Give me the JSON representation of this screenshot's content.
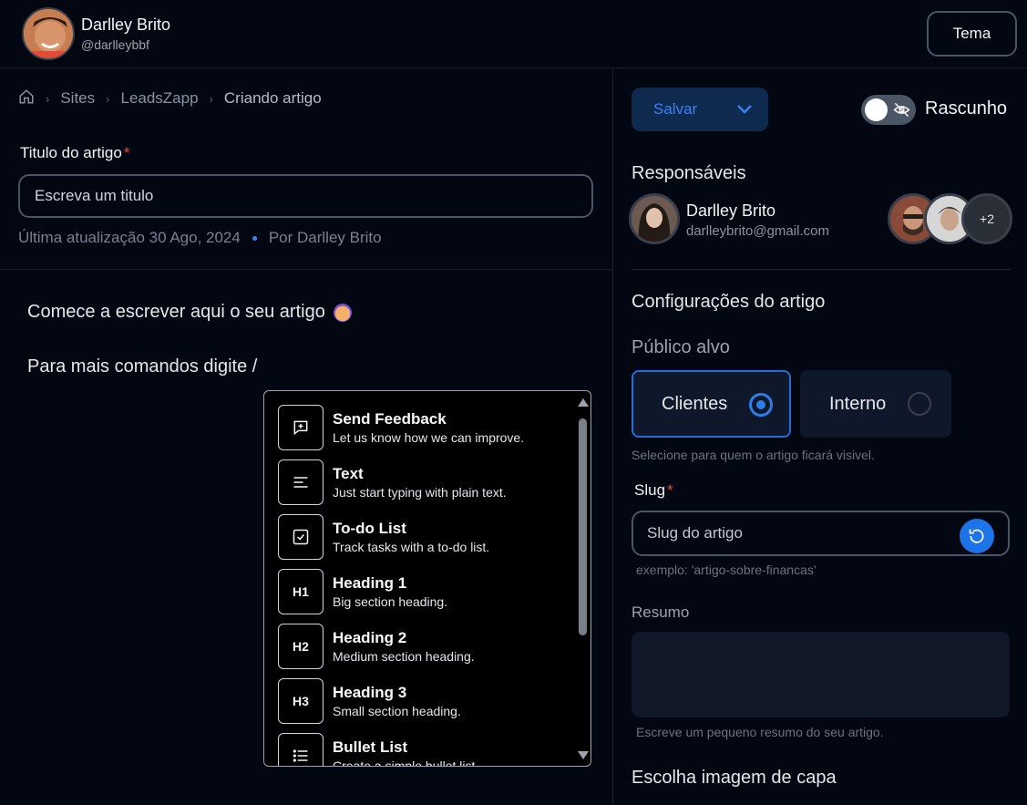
{
  "header": {
    "user_name": "Darlley Brito",
    "user_handle": "@darlleybbf",
    "theme_button": "Tema"
  },
  "breadcrumb": {
    "items": [
      "Sites",
      "LeadsZapp"
    ],
    "current": "Criando artigo"
  },
  "article": {
    "title_label": "Titulo do artigo",
    "required_mark": "*",
    "title_placeholder": "Escreva um titulo",
    "last_update": "Última atualização 30 Ago, 2024",
    "author": "Por Darlley Brito"
  },
  "editor": {
    "line1": "Comece a escrever aqui o seu artigo",
    "line2": "Para mais comandos digite /"
  },
  "command_menu": {
    "items": [
      {
        "title": "Send Feedback",
        "desc": "Let us know how we can improve.",
        "icon": "feedback-icon"
      },
      {
        "title": "Text",
        "desc": "Just start typing with plain text.",
        "icon": "text-icon"
      },
      {
        "title": "To-do List",
        "desc": "Track tasks with a to-do list.",
        "icon": "checkbox-icon"
      },
      {
        "title": "Heading 1",
        "desc": "Big section heading.",
        "icon": "H1"
      },
      {
        "title": "Heading 2",
        "desc": "Medium section heading.",
        "icon": "H2"
      },
      {
        "title": "Heading 3",
        "desc": "Small section heading.",
        "icon": "H3"
      },
      {
        "title": "Bullet List",
        "desc": "Create a simple bullet list.",
        "icon": "bullet-list-icon"
      }
    ]
  },
  "sidebar": {
    "save_label": "Salvar",
    "draft_label": "Rascunho",
    "responsaveis_title": "Responsáveis",
    "responsible": {
      "name": "Darlley Brito",
      "email": "darlleybrito@gmail.com"
    },
    "more_count": "+2",
    "config_title": "Configurações do artigo",
    "audience_title": "Público alvo",
    "audience_options": [
      "Clientes",
      "Interno"
    ],
    "audience_selected": "Clientes",
    "audience_help": "Selecione para quem o artigo ficará visivel.",
    "slug_label": "Slug",
    "slug_placeholder": "Slug do artigo",
    "slug_help": "exemplo: 'artigo-sobre-financas'",
    "resumo_label": "Resumo",
    "resumo_help": "Escreve um pequeno resumo do seu artigo.",
    "cover_title": "Escolha imagem de capa"
  },
  "colors": {
    "background": "#030712",
    "accent": "#3b82f6",
    "required": "#ef4444"
  }
}
